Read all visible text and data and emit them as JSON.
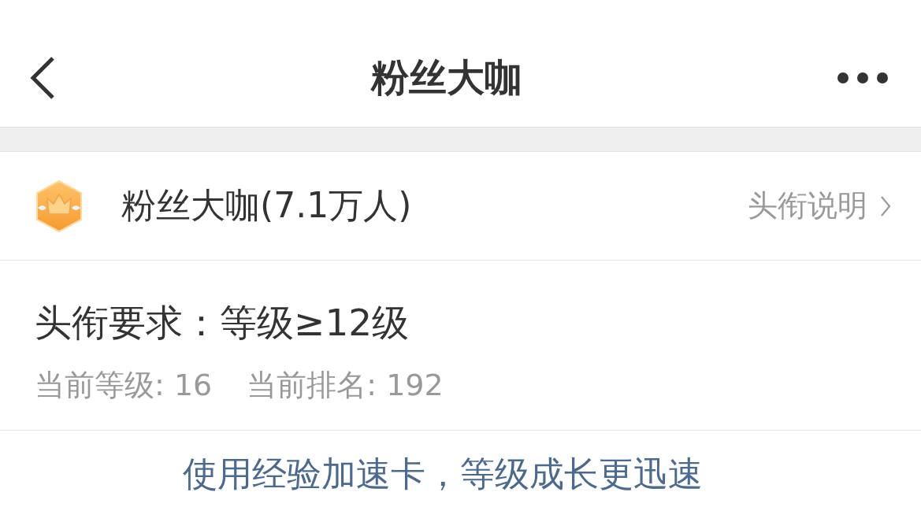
{
  "nav": {
    "title": "粉丝大咖"
  },
  "title_row": {
    "name": "粉丝大咖(7.1万人)",
    "link": "头衔说明"
  },
  "requirement": {
    "text": "头衔要求：等级≥12级",
    "stats": [
      "当前等级: 16",
      "当前排名: 192"
    ]
  },
  "promo": {
    "text": "使用经验加速卡，等级成长更迅速"
  }
}
